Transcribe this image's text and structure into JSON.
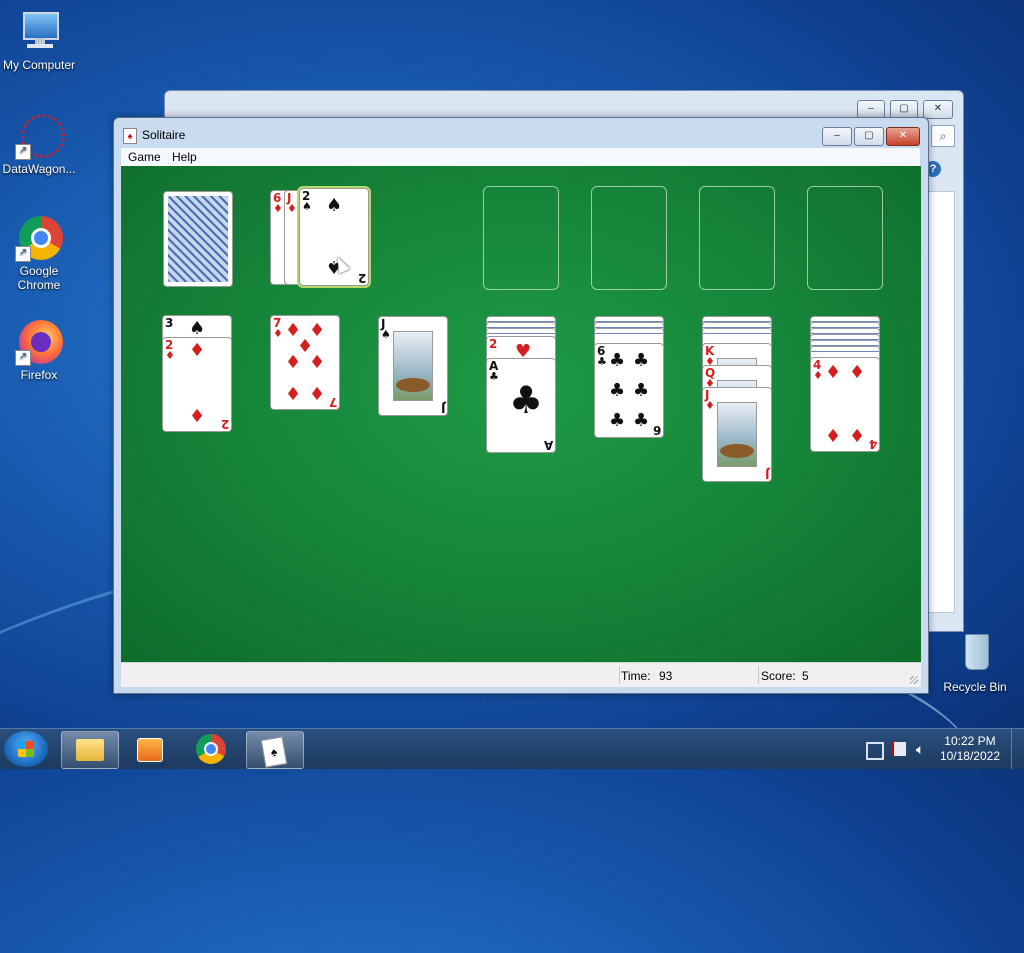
{
  "desktop": {
    "icons": [
      {
        "label": "My Computer"
      },
      {
        "label": "DataWagon..."
      },
      {
        "label": "Google Chrome"
      },
      {
        "label": "Firefox"
      },
      {
        "label": "Recycle Bin"
      }
    ]
  },
  "window": {
    "title": "Solitaire",
    "controls": {
      "minimize": "‒",
      "maximize": "▢",
      "close": "✕"
    }
  },
  "menu": {
    "game": "Game",
    "help": "Help"
  },
  "status": {
    "time_label": "Time:",
    "time_value": "93",
    "score_label": "Score:",
    "score_value": "5"
  },
  "game": {
    "waste": [
      {
        "rank": "6",
        "suit": "♦",
        "color": "red"
      },
      {
        "rank": "J",
        "suit": "♦",
        "color": "red"
      },
      {
        "rank": "2",
        "suit": "♠",
        "color": "black"
      }
    ],
    "tableau": [
      {
        "hidden": 0,
        "cards": [
          {
            "rank": "3",
            "suit": "♠",
            "color": "black"
          },
          {
            "rank": "2",
            "suit": "♦",
            "color": "red"
          }
        ]
      },
      {
        "hidden": 0,
        "cards": [
          {
            "rank": "7",
            "suit": "♦",
            "color": "red"
          }
        ]
      },
      {
        "hidden": 0,
        "cards": [
          {
            "rank": "J",
            "suit": "♠",
            "color": "black"
          }
        ]
      },
      {
        "hidden": 3,
        "cards": [
          {
            "rank": "2",
            "suit": "♥",
            "color": "red"
          },
          {
            "rank": "A",
            "suit": "♣",
            "color": "black"
          }
        ]
      },
      {
        "hidden": 3,
        "cards": [
          {
            "rank": "6",
            "suit": "♣",
            "color": "black"
          }
        ]
      },
      {
        "hidden": 3,
        "cards": [
          {
            "rank": "K",
            "suit": "♦",
            "color": "red"
          },
          {
            "rank": "Q",
            "suit": "♦",
            "color": "red"
          },
          {
            "rank": "J",
            "suit": "♦",
            "color": "red"
          }
        ]
      },
      {
        "hidden": 6,
        "cards": [
          {
            "rank": "4",
            "suit": "♦",
            "color": "red"
          }
        ]
      }
    ]
  },
  "taskbar": {
    "clock_time": "10:22 PM",
    "clock_date": "10/18/2022"
  },
  "colors": {
    "felt": "#178a3c",
    "desktop": "#1a5fb5",
    "red_suit": "#d41f1f"
  }
}
